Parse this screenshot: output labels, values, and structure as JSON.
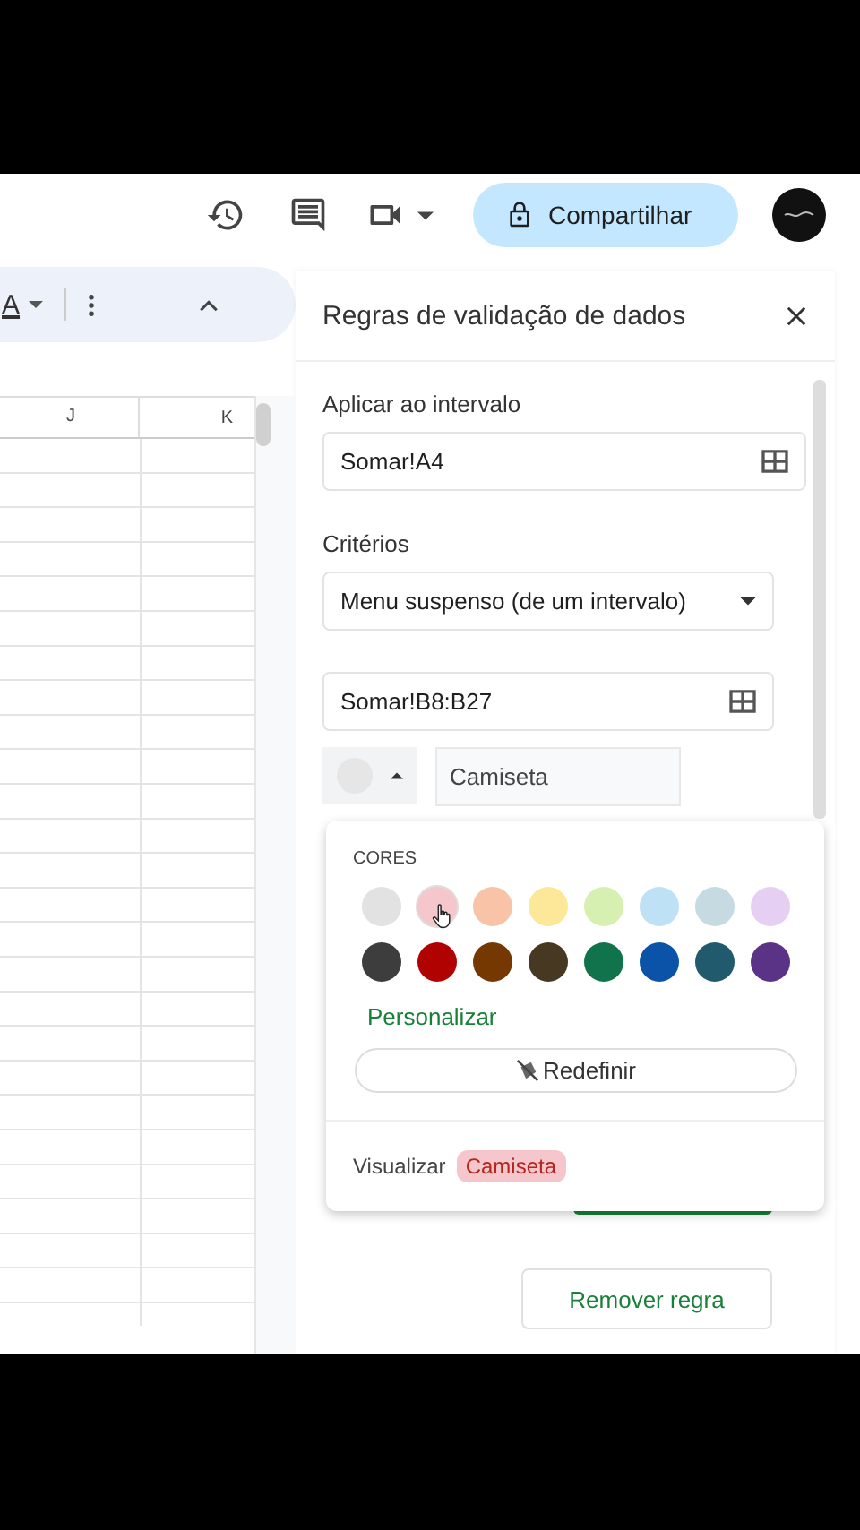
{
  "topbar": {
    "share_button": "Compartilhar"
  },
  "toolbar": {
    "text_color_glyph": "A"
  },
  "sheet": {
    "columns": [
      "J",
      "K"
    ]
  },
  "panel": {
    "title": "Regras de validação de dados",
    "range_label": "Aplicar ao intervalo",
    "range_value": "Somar!A4",
    "criteria_label": "Critérios",
    "criteria_value": "Menu suspenso (de um intervalo)",
    "source_range": "Somar!B8:B27",
    "option_value": "Camiseta",
    "remove_button": "Remover regra"
  },
  "color_popup": {
    "heading": "CORES",
    "swatches": [
      {
        "color": "#e2e2e2",
        "selected": false
      },
      {
        "color": "#f5c6cb",
        "selected": true
      },
      {
        "color": "#f8c3a6",
        "selected": false
      },
      {
        "color": "#fde89a",
        "selected": false
      },
      {
        "color": "#d6f0b2",
        "selected": false
      },
      {
        "color": "#bfe1f6",
        "selected": false
      },
      {
        "color": "#c6dbe1",
        "selected": false
      },
      {
        "color": "#e5cff2",
        "selected": false
      },
      {
        "color": "#3d3d3d",
        "selected": false
      },
      {
        "color": "#b10202",
        "selected": false
      },
      {
        "color": "#753800",
        "selected": false
      },
      {
        "color": "#473822",
        "selected": false
      },
      {
        "color": "#11734b",
        "selected": false
      },
      {
        "color": "#0a53a8",
        "selected": false
      },
      {
        "color": "#215a6c",
        "selected": false
      },
      {
        "color": "#5a3286",
        "selected": false
      }
    ],
    "custom_link": "Personalizar",
    "reset_button": "Redefinir",
    "preview_label": "Visualizar",
    "preview_chip": "Camiseta"
  }
}
